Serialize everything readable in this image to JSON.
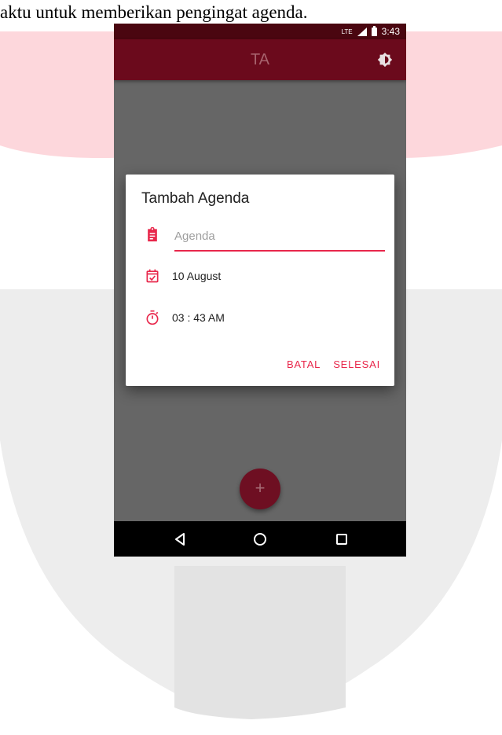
{
  "caption": "aktu untuk memberikan pengingat agenda.",
  "status_bar": {
    "network": "LTE",
    "time": "3:43"
  },
  "app_bar": {
    "title": "TA"
  },
  "dialog": {
    "title": "Tambah Agenda",
    "agenda_placeholder": "Agenda",
    "agenda_value": "",
    "date": "10 August",
    "time": "03 : 43 AM",
    "cancel_label": "BATAL",
    "done_label": "SELESAI"
  },
  "fab": {
    "label": "+"
  },
  "colors": {
    "accent": "#e8274b",
    "primary": "#6b0a1c",
    "status": "#4a0610"
  }
}
